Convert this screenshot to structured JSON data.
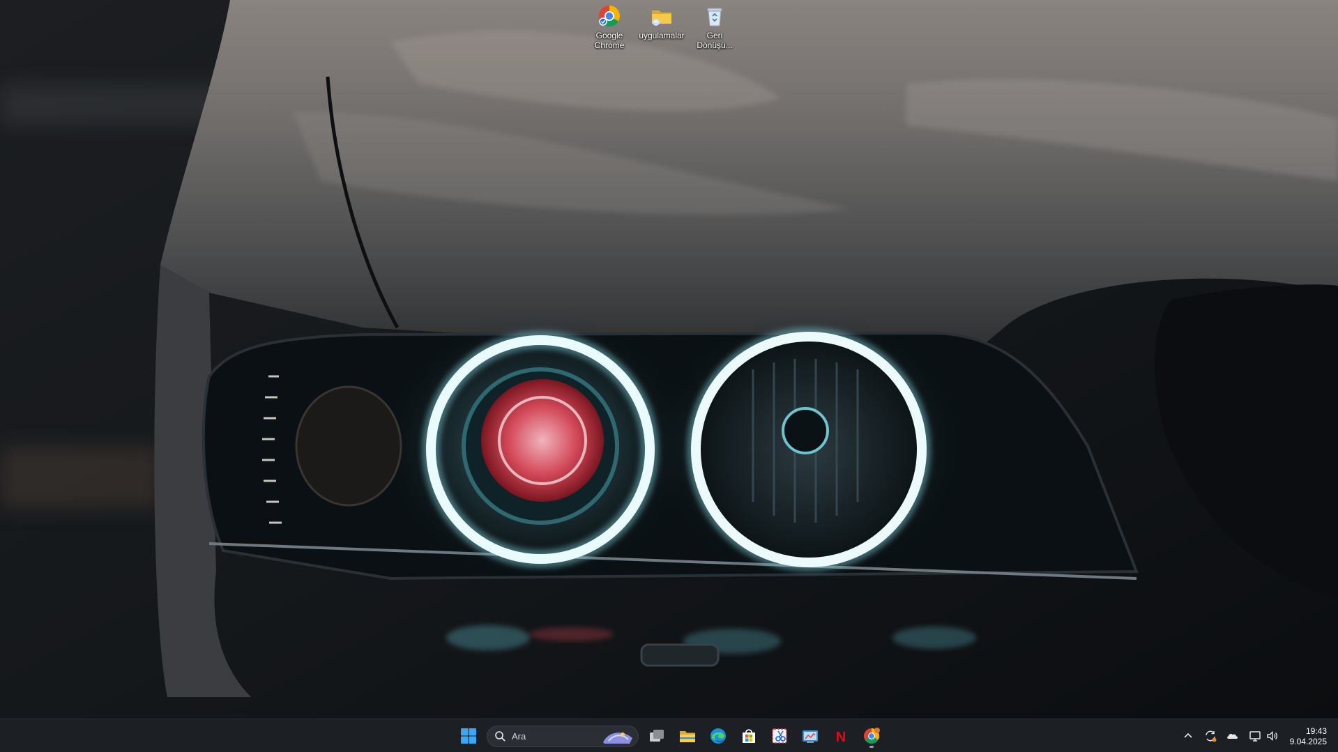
{
  "desktop": {
    "icons": [
      {
        "label": "Google Chrome",
        "icon": "chrome-icon"
      },
      {
        "label": "uygulamalar",
        "icon": "folder-icon"
      },
      {
        "label": "Geri Dönüşü...",
        "icon": "recycle-bin-icon"
      }
    ]
  },
  "taskbar": {
    "search_placeholder": "Ara",
    "apps": [
      "start-icon",
      "task-view-icon",
      "file-explorer-icon",
      "edge-icon",
      "store-icon",
      "snipping-tool-icon",
      "control-panel-icon",
      "netflix-icon",
      "chrome-icon"
    ],
    "netflix_letter": "N",
    "tray": [
      "chevron-up-icon",
      "sync-icon",
      "onedrive-icon",
      "network-icon",
      "volume-icon"
    ],
    "time": "19:43",
    "date": "9.04.2025"
  },
  "colors": {
    "taskbar_bg": "#1c1f24",
    "halo": "#cfeef2",
    "red_ring": "#d83a4a"
  }
}
